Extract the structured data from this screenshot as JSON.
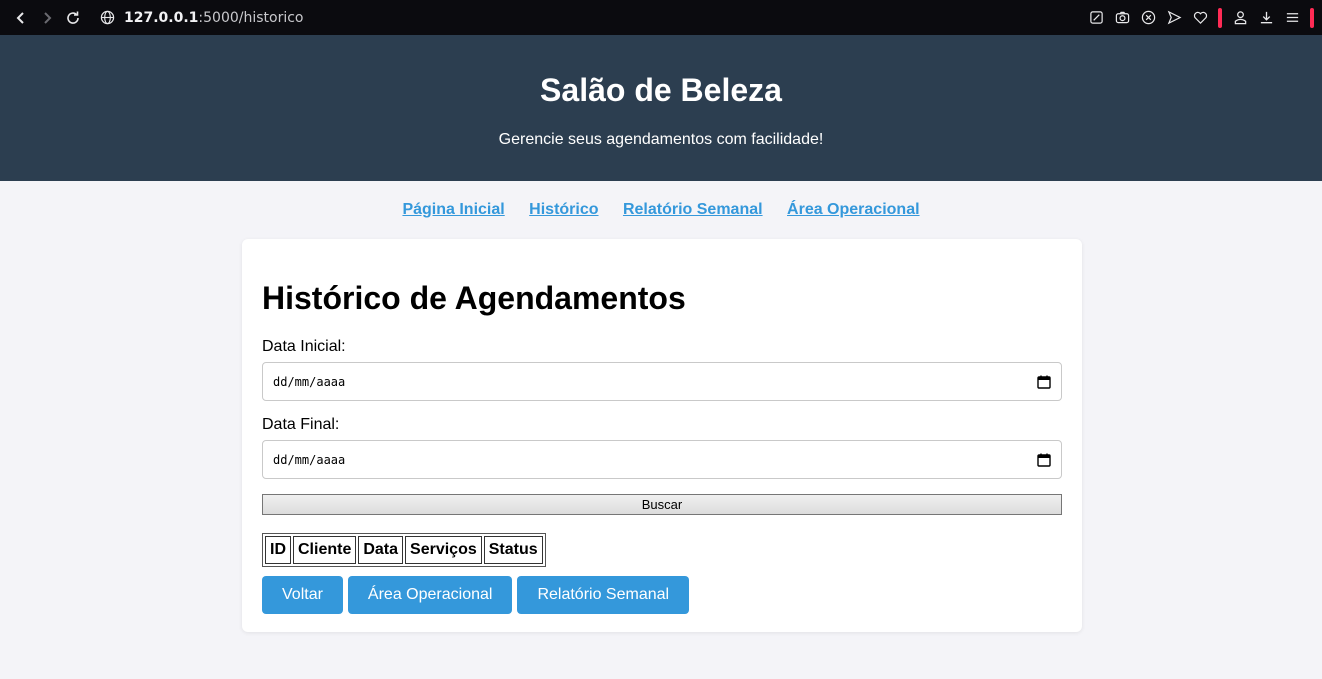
{
  "browser": {
    "url_host": "127.0.0.1",
    "url_rest": ":5000/historico"
  },
  "header": {
    "title": "Salão de Beleza",
    "subtitle": "Gerencie seus agendamentos com facilidade!"
  },
  "nav": {
    "links": [
      "Página Inicial",
      "Histórico",
      "Relatório Semanal",
      "Área Operacional"
    ]
  },
  "main": {
    "heading": "Histórico de Agendamentos",
    "start_label": "Data Inicial:",
    "start_value": "dd/mm/aaaa",
    "end_label": "Data Final:",
    "end_value": "dd/mm/aaaa",
    "search_button": "Buscar",
    "table_headers": [
      "ID",
      "Cliente",
      "Data",
      "Serviços",
      "Status"
    ],
    "buttons": [
      "Voltar",
      "Área Operacional",
      "Relatório Semanal"
    ]
  },
  "colors": {
    "header_bg": "#2c3e50",
    "accent": "#3498db",
    "page_bg": "#f4f4f8"
  }
}
